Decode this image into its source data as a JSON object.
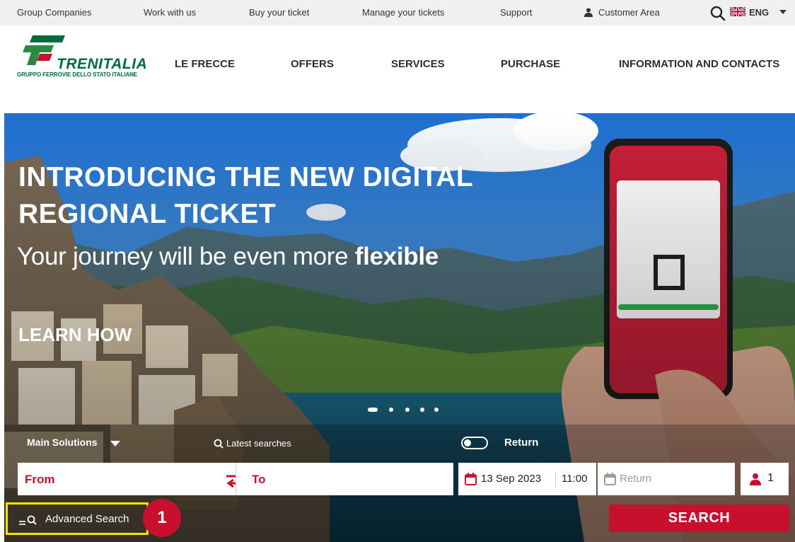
{
  "topbar": {
    "links": [
      "Group Companies",
      "Work with us",
      "Buy your ticket",
      "Manage your tickets",
      "Support"
    ],
    "customer_area": "Customer Area",
    "language": "ENG"
  },
  "header": {
    "brand": "TRENITALIA",
    "brand_sub": "GRUPPO FERROVIE DELLO STATO ITALIANE",
    "nav": [
      "LE FRECCE",
      "OFFERS",
      "SERVICES",
      "PURCHASE",
      "INFORMATION AND CONTACTS"
    ]
  },
  "hero": {
    "headline_line1": "INTRODUCING THE NEW DIGITAL",
    "headline_line2": "REGIONAL TICKET",
    "subline_regular": "Your journey will be even more ",
    "subline_bold": "flexible",
    "cta": "LEARN HOW",
    "slides_total": 5,
    "slide_active": 1
  },
  "search": {
    "main_solutions": "Main Solutions",
    "latest_searches": "Latest searches",
    "return_toggle_label": "Return",
    "return_toggle_on": false,
    "from_label": "From",
    "to_label": "To",
    "date": "13 Sep 2023",
    "time": "11:00",
    "return_placeholder": "Return",
    "passengers": "1",
    "advanced_search": "Advanced Search",
    "search_button": "SEARCH"
  },
  "annotation": {
    "step_number": "1"
  },
  "colors": {
    "brand_red": "#c8102e",
    "brand_green": "#006b3e",
    "highlight": "#f4e400"
  }
}
